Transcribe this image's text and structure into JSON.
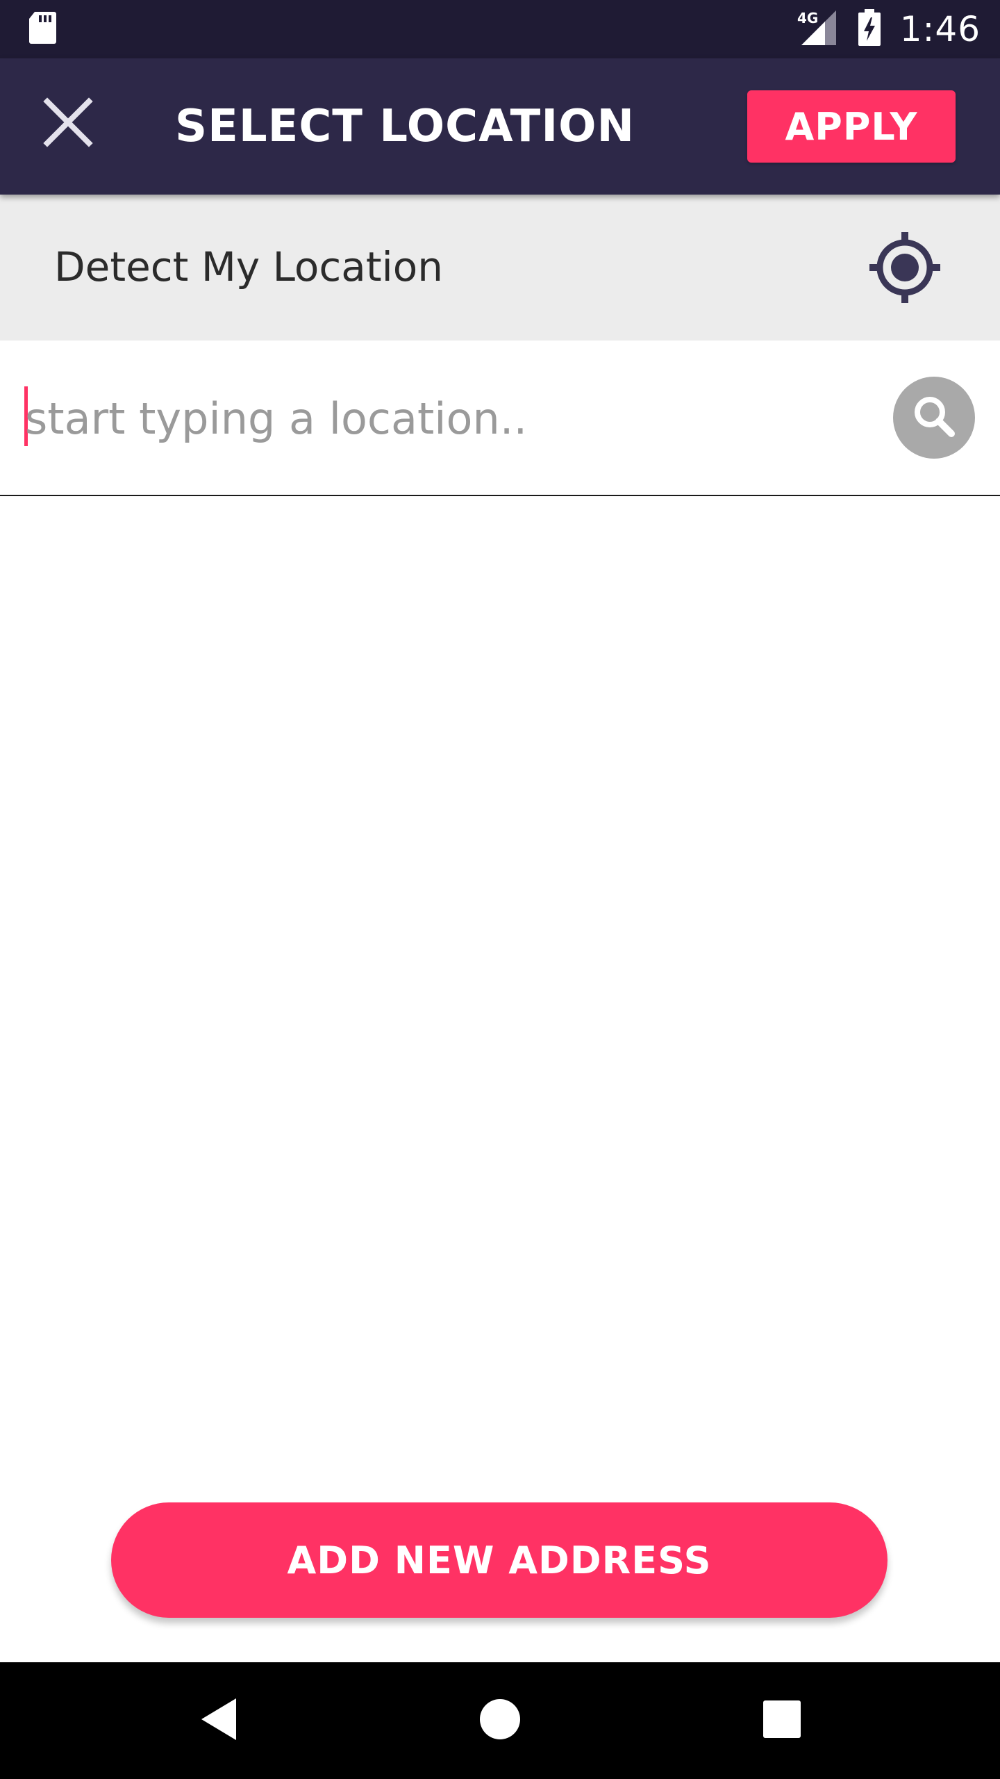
{
  "status_bar": {
    "time": "1:46",
    "network": "4G",
    "icons": [
      "sd-card-icon",
      "signal-4g-icon",
      "battery-charging-icon"
    ]
  },
  "app_bar": {
    "title": "SELECT LOCATION",
    "apply_label": "APPLY",
    "close_icon": "close-icon"
  },
  "detect_location": {
    "label": "Detect My Location",
    "icon": "gps-fixed-icon"
  },
  "search": {
    "placeholder": "start typing a location..",
    "value": "",
    "icon": "search-icon"
  },
  "footer": {
    "add_address_label": "ADD NEW ADDRESS"
  },
  "nav_bar": {
    "icons": [
      "back-icon",
      "home-icon",
      "recents-icon"
    ]
  },
  "colors": {
    "status_bar": "#1f1b34",
    "app_bar": "#2d2848",
    "accent": "#ff3264",
    "detect_row_bg": "#ececec",
    "search_button_bg": "#a9a9a9",
    "nav_bar": "#000000"
  }
}
